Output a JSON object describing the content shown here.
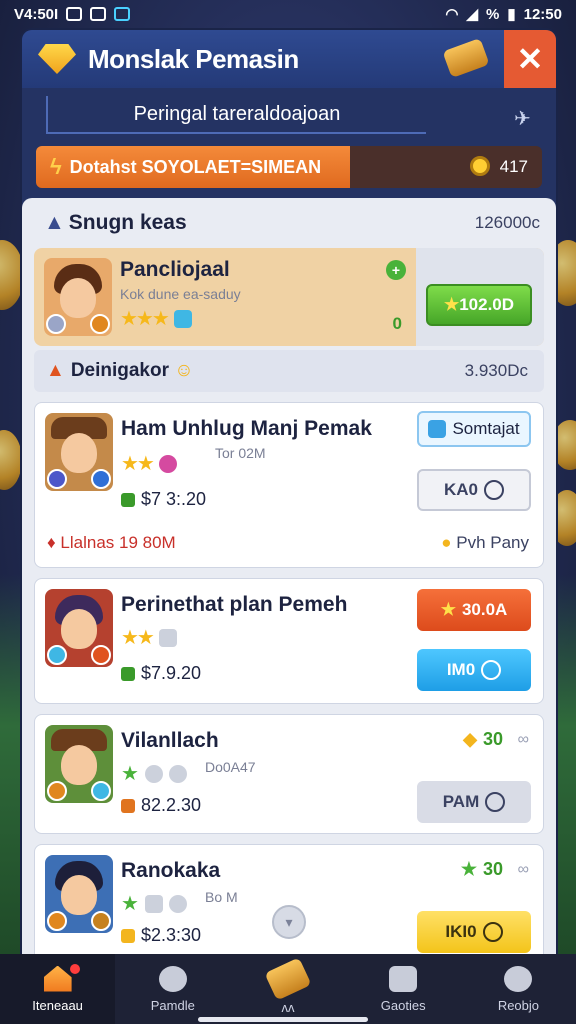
{
  "status_bar": {
    "time_left": "V4:50I",
    "time_right": "12:50",
    "percent": "%"
  },
  "header": {
    "title": "Monslak Pemasin",
    "close_label": "✕"
  },
  "subbar": {
    "text": "Peringal tareraldoajoan"
  },
  "banner": {
    "text": "Dotahst SOYOLAET=SIMEAN",
    "value": "417",
    "progress": 0.62,
    "accent": "#e06a1f"
  },
  "list_header": {
    "title": "Snugn keas",
    "value": "126000c"
  },
  "featured": {
    "name": "Pancliojaal",
    "sub": "Kok dune ea-saduy",
    "stars": "★★★",
    "zero": "0",
    "button": "102.0D"
  },
  "subhead": {
    "title": "Deinigakor",
    "value": "3.930Dc"
  },
  "cards": [
    {
      "name": "Ham Unhlug Manj Pemak",
      "sub": "Tor 02M",
      "stars": "★★",
      "money": "$7 3:.20",
      "action_top": "Somtajat",
      "action": "KA0",
      "footer_left": "Llalnas 19 80M",
      "footer_right": "Pvh Pany"
    },
    {
      "name": "Perinethat plan Pemeh",
      "stars": "★★",
      "money": "$7.9.20",
      "action_top": "30.0A",
      "action": "IM0"
    },
    {
      "name": "Vilanllach",
      "sub": "Do0A47",
      "money": "82.2.30",
      "reward": "30",
      "action": "PAM"
    },
    {
      "name": "Ranokaka",
      "sub": "Bo M",
      "money": "$2.3:30",
      "reward": "30",
      "action": "IKI0"
    }
  ],
  "nav": [
    {
      "label": "Iteneaau"
    },
    {
      "label": "Pamdle"
    },
    {
      "label": "ʌʌ"
    },
    {
      "label": "Gaoties"
    },
    {
      "label": "Reobjo"
    }
  ]
}
